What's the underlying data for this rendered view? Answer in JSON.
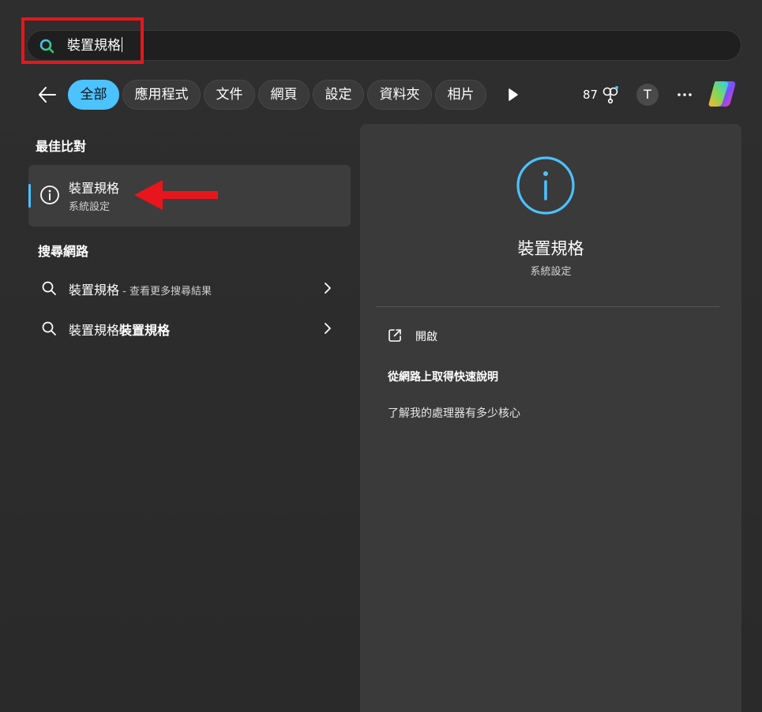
{
  "search": {
    "query": "裝置規格"
  },
  "filters": {
    "tabs": [
      {
        "label": "全部",
        "active": true
      },
      {
        "label": "應用程式"
      },
      {
        "label": "文件"
      },
      {
        "label": "網頁"
      },
      {
        "label": "設定"
      },
      {
        "label": "資料夾"
      },
      {
        "label": "相片"
      }
    ],
    "points": "87",
    "avatar_initial": "T"
  },
  "best_match": {
    "section_title": "最佳比對",
    "title": "裝置規格",
    "subtitle": "系統設定",
    "icon": "info-circle-icon"
  },
  "web_search": {
    "section_title": "搜尋網路",
    "items": [
      {
        "query": "裝置規格",
        "suffix": " - 查看更多搜尋結果"
      },
      {
        "query": "裝置規格",
        "bold_suffix": "裝置規格"
      }
    ]
  },
  "detail": {
    "title": "裝置規格",
    "subtitle": "系統設定",
    "open_label": "開啟",
    "help_title": "從網路上取得快速說明",
    "help_link": "了解我的處理器有多少核心"
  },
  "colors": {
    "accent": "#4cc2ff",
    "annotation_red": "#e8161c",
    "panel": "#3a3a3a",
    "background": "#2b2b2b"
  }
}
